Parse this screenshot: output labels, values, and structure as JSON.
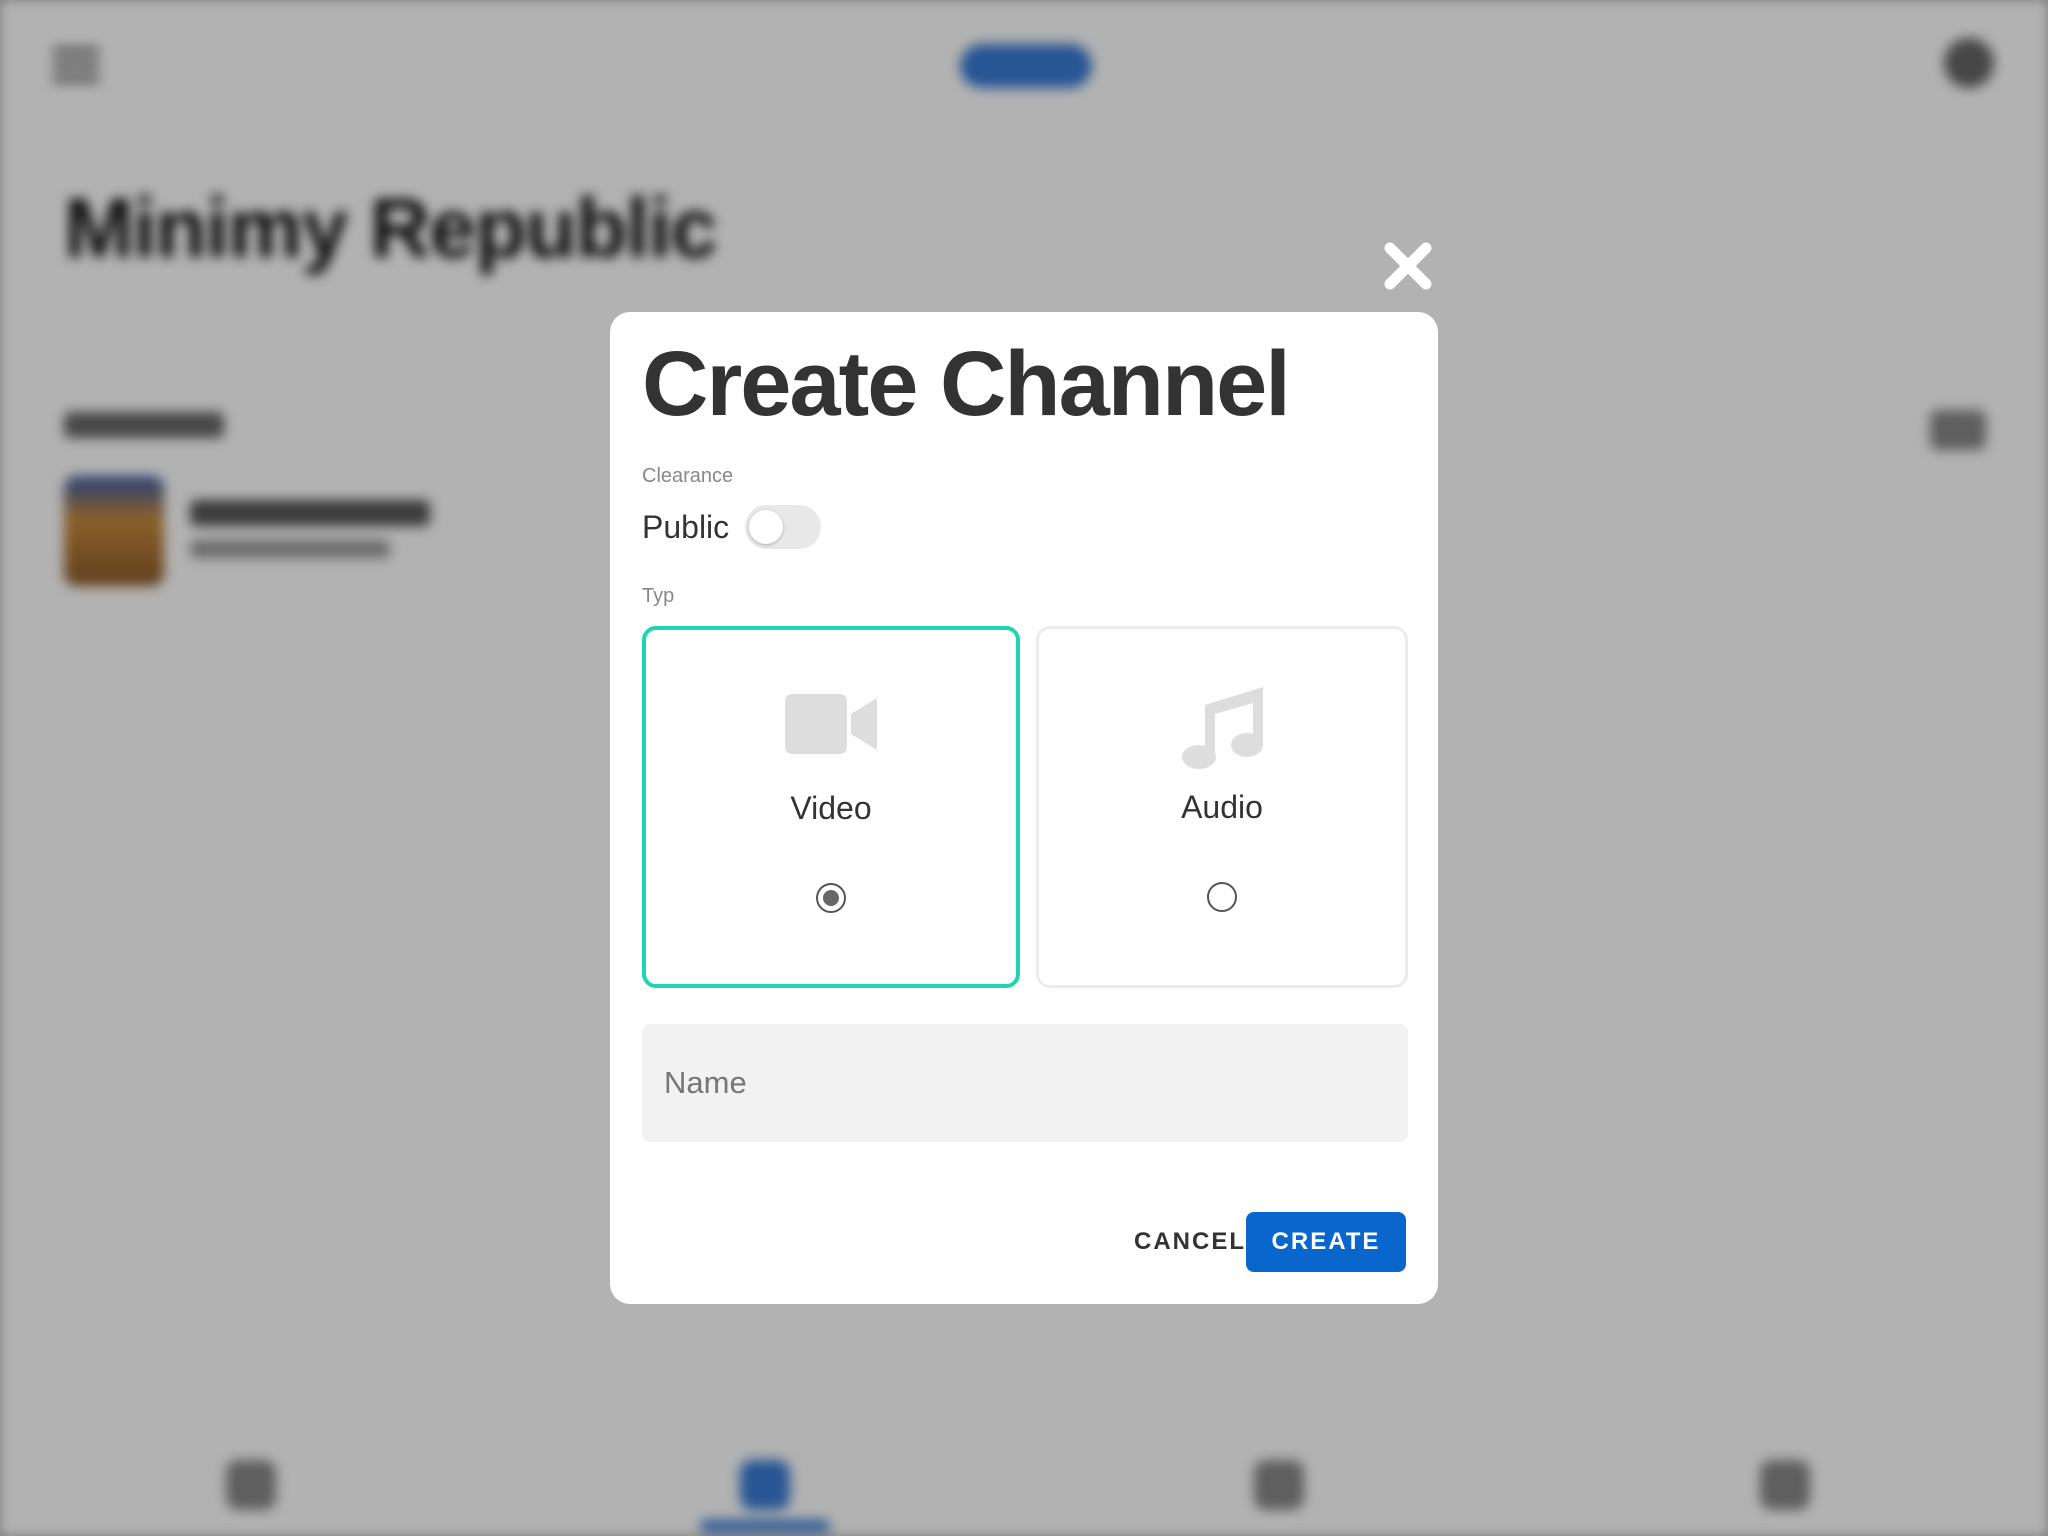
{
  "background": {
    "title": "Minimy Republic"
  },
  "dialog": {
    "title": "Create Channel",
    "clearance": {
      "label": "Clearance",
      "toggle_label": "Public",
      "toggle_on": false
    },
    "type": {
      "label": "Typ",
      "options": [
        {
          "label": "Video",
          "icon": "video-camera-icon",
          "selected": true
        },
        {
          "label": "Audio",
          "icon": "music-note-icon",
          "selected": false
        }
      ]
    },
    "name_field": {
      "placeholder": "Name",
      "value": ""
    },
    "buttons": {
      "cancel": "CANCEL",
      "create": "CREATE"
    }
  },
  "colors": {
    "accent_selected": "#1fd4b4",
    "primary_button": "#0866cc",
    "icon_gray": "#dddddd"
  }
}
